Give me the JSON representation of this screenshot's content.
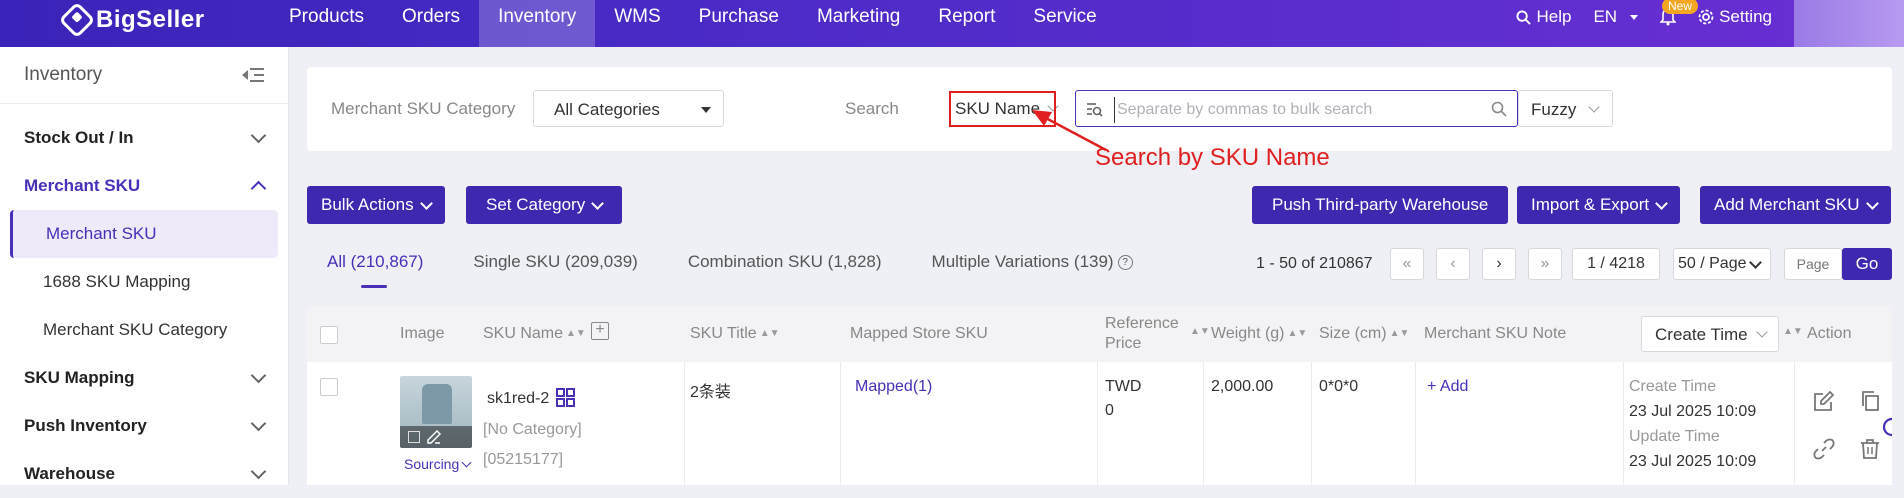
{
  "brand": {
    "name": "BigSeller"
  },
  "nav": {
    "items": [
      "Products",
      "Orders",
      "Inventory",
      "WMS",
      "Purchase",
      "Marketing",
      "Report",
      "Service"
    ],
    "active": "Inventory"
  },
  "topright": {
    "help": "Help",
    "lang": "EN",
    "new_badge": "New",
    "settings": "Setting"
  },
  "sidebar": {
    "title": "Inventory",
    "groups": [
      {
        "label": "Stock Out / In"
      },
      {
        "label": "Merchant SKU"
      },
      {
        "label": "SKU Mapping"
      },
      {
        "label": "Push Inventory"
      },
      {
        "label": "Warehouse"
      }
    ],
    "subitems": [
      "Merchant SKU",
      "1688 SKU Mapping",
      "Merchant SKU Category"
    ]
  },
  "filter": {
    "category_label": "Merchant SKU Category",
    "category_value": "All Categories",
    "search_label": "Search",
    "search_field": "SKU Name",
    "search_placeholder": "Separate by commas to bulk search",
    "match_mode": "Fuzzy"
  },
  "annotation": "Search by SKU Name",
  "toolbar": {
    "bulk_actions": "Bulk Actions",
    "set_category": "Set Category",
    "push_third_party": "Push Third-party Warehouse",
    "import_export": "Import & Export",
    "add_sku": "Add Merchant SKU"
  },
  "tabs": [
    "All (210,867)",
    "Single SKU (209,039)",
    "Combination SKU (1,828)",
    "Multiple Variations (139)"
  ],
  "pagination": {
    "range": "1 - 50 of 210867",
    "current": "1 / 4218",
    "page_size": "50 / Page",
    "page_placeholder": "Page",
    "go": "Go"
  },
  "table": {
    "headers": {
      "image": "Image",
      "sku_name": "SKU Name",
      "sku_title": "SKU Title",
      "mapped": "Mapped Store SKU",
      "ref_price_1": "Reference",
      "ref_price_2": "Price",
      "weight": "Weight (g)",
      "size": "Size (cm)",
      "note": "Merchant SKU Note",
      "time_select": "Create Time",
      "action": "Action"
    },
    "row": {
      "sourcing": "Sourcing",
      "sku_name": "sk1red-2",
      "category": "[No Category]",
      "sku_id": "[05215177]",
      "title": "2条装",
      "mapped": "Mapped(1)",
      "currency": "TWD",
      "price": "0",
      "weight": "2,000.00",
      "size": "0*0*0",
      "note_add": "+ Add",
      "create_label": "Create Time",
      "create_time": "23 Jul 2025 10:09",
      "update_label": "Update Time",
      "update_time": "23 Jul 2025 10:09"
    }
  },
  "colors": {
    "brand": "#4a2fb8",
    "annotation": "#e02020"
  }
}
